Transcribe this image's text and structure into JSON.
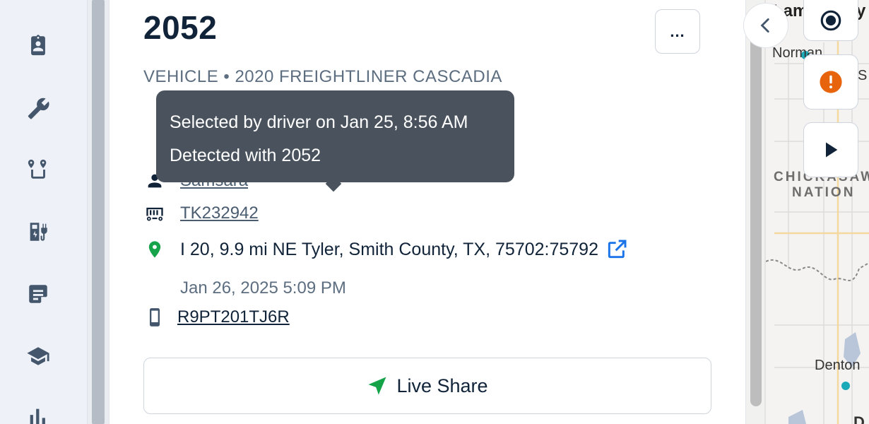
{
  "sidebar": {
    "icons": [
      "clipboard-icon",
      "wrench-icon",
      "route-icon",
      "fuel-charging-icon",
      "document-icon",
      "graduation-cap-icon",
      "bar-chart-icon"
    ]
  },
  "panel": {
    "title": "2052",
    "more_label": "...",
    "subtitle": "VEHICLE • 2020 FREIGHTLINER CASCADIA",
    "driver_link": "Samsara",
    "trailer_link": "TK232942",
    "location": "I 20, 9.9 mi NE Tyler, Smith County, TX, 75702:75792",
    "location_time": "Jan 26, 2025 5:09 PM",
    "device_link": "R9PT201TJ6R",
    "live_share_label": "Live Share"
  },
  "tooltip": {
    "line1": "Selected by driver on Jan 25, 8:56 AM",
    "line2": "Detected with 2052"
  },
  "map": {
    "labels": {
      "top": "Lam",
      "top_right": "y",
      "norman": "Norman",
      "s_label": "S",
      "chickasaw": "CHICKASAW",
      "nation": "NATION",
      "denton": "Denton",
      "bottom": "D"
    }
  },
  "colors": {
    "accent_blue": "#1a73e8",
    "live_share_green": "#15a34a",
    "location_green": "#16a34a",
    "alert_orange": "#e8640c"
  }
}
